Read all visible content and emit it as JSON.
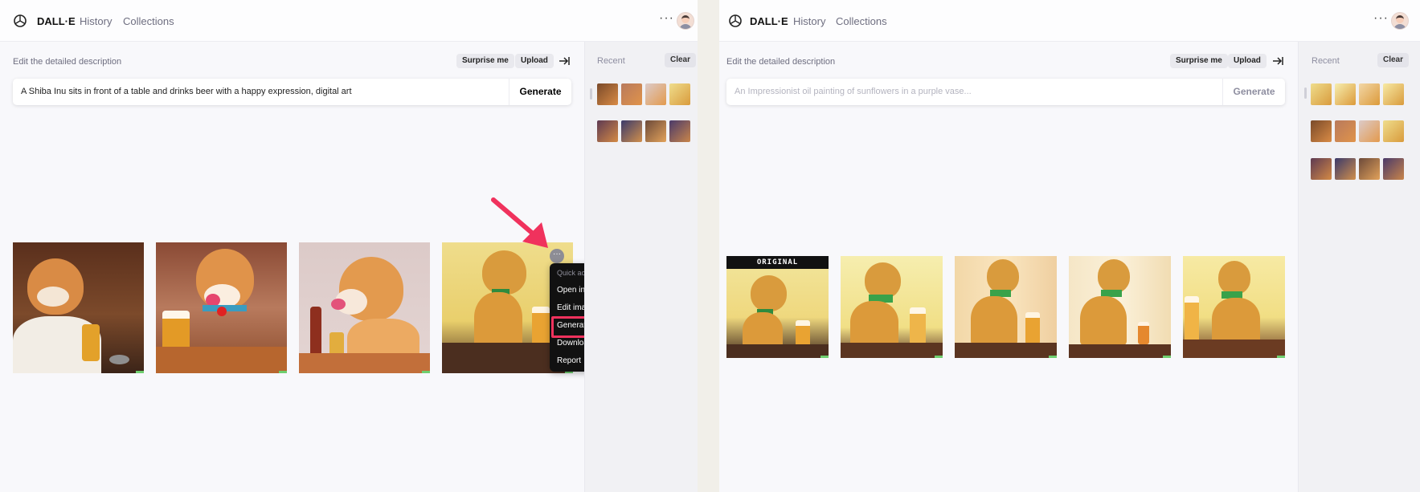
{
  "colors": {
    "accent_pink": "#f0325d",
    "menu_bg": "#111111",
    "sidebar_bg": "#f1f1f4",
    "generate_variation_corner": "#6fcf6f"
  },
  "left": {
    "topbar": {
      "brand": "DALL·E",
      "nav_history": "History",
      "nav_collections": "Collections",
      "more": "···"
    },
    "desc_label": "Edit the detailed description",
    "surprise_label": "Surprise me",
    "upload_label": "Upload",
    "prompt_value": "A Shiba Inu sits in front of a table and drinks beer with a happy expression, digital art",
    "generate_label": "Generate",
    "sidebar": {
      "recent_label": "Recent",
      "clear_label": "Clear"
    },
    "results_count": 4,
    "quick_actions": {
      "header": "Quick actions",
      "items": [
        "Open in new tab",
        "Edit image",
        "Generate variations",
        "Download",
        "Report"
      ],
      "highlighted": "Generate variations"
    }
  },
  "right": {
    "topbar": {
      "brand": "DALL·E",
      "nav_history": "History",
      "nav_collections": "Collections",
      "more": "···"
    },
    "desc_label": "Edit the detailed description",
    "surprise_label": "Surprise me",
    "upload_label": "Upload",
    "prompt_placeholder": "An Impressionist oil painting of sunflowers in a purple vase...",
    "generate_label": "Generate",
    "sidebar": {
      "recent_label": "Recent",
      "clear_label": "Clear"
    },
    "original_label": "ORIGINAL",
    "results_count": 5
  }
}
